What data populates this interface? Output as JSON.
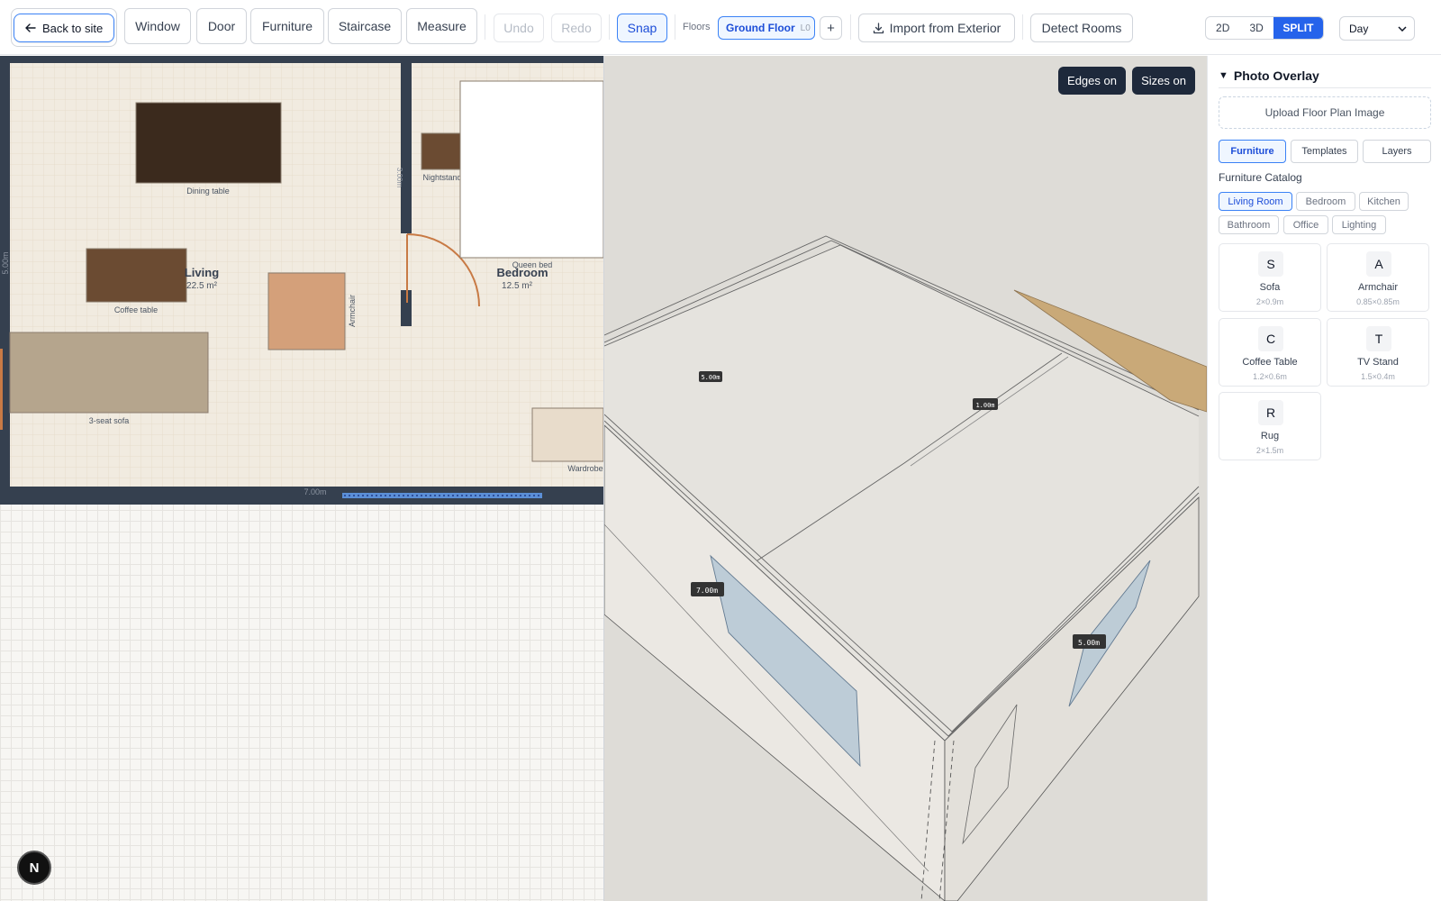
{
  "toolbar": {
    "back_label": "Back to site",
    "tools": [
      "Window",
      "Door",
      "Furniture",
      "Staircase",
      "Measure"
    ],
    "undo": "Undo",
    "redo": "Redo",
    "snap": "Snap",
    "floors_label": "Floors",
    "floor_name": "Ground Floor",
    "floor_level": "L0",
    "add_floor": "+",
    "import_label": "Import from Exterior",
    "detect_label": "Detect Rooms",
    "view_modes": [
      "2D",
      "3D",
      "SPLIT"
    ],
    "active_view": "SPLIT",
    "time_of_day": "Day"
  },
  "plan2d": {
    "rooms": [
      {
        "name": "Living",
        "area": "22.5 m²"
      },
      {
        "name": "Bedroom",
        "area": "12.5 m²"
      }
    ],
    "furniture": [
      "Dining table",
      "Coffee table",
      "3-seat sofa",
      "Armchair",
      "Nightstand",
      "Queen bed",
      "Wardrobe"
    ],
    "dims": {
      "width": "7.00m",
      "height": "5.00m",
      "partition": "3.00m"
    },
    "colors": {
      "wall": "#35404f",
      "floor": "#f1ebe0",
      "door": "#c87a45",
      "window": "#5b8fd6"
    }
  },
  "view3d": {
    "edges_btn": "Edges on",
    "sizes_btn": "Sizes on",
    "labels": [
      "5.00m",
      "1.00m",
      "7.00m",
      "5.00m"
    ]
  },
  "sidebar": {
    "section_title": "Photo Overlay",
    "upload_label": "Upload Floor Plan Image",
    "tabs": [
      "Furniture",
      "Templates",
      "Layers"
    ],
    "catalog_title": "Furniture Catalog",
    "categories": [
      "Living Room",
      "Bedroom",
      "Kitchen",
      "Bathroom",
      "Office",
      "Lighting"
    ],
    "items": [
      {
        "letter": "S",
        "name": "Sofa",
        "dims": "2×0.9m"
      },
      {
        "letter": "A",
        "name": "Armchair",
        "dims": "0.85×0.85m"
      },
      {
        "letter": "C",
        "name": "Coffee Table",
        "dims": "1.2×0.6m"
      },
      {
        "letter": "T",
        "name": "TV Stand",
        "dims": "1.5×0.4m"
      },
      {
        "letter": "R",
        "name": "Rug",
        "dims": "2×1.5m"
      }
    ]
  },
  "badge": "N"
}
